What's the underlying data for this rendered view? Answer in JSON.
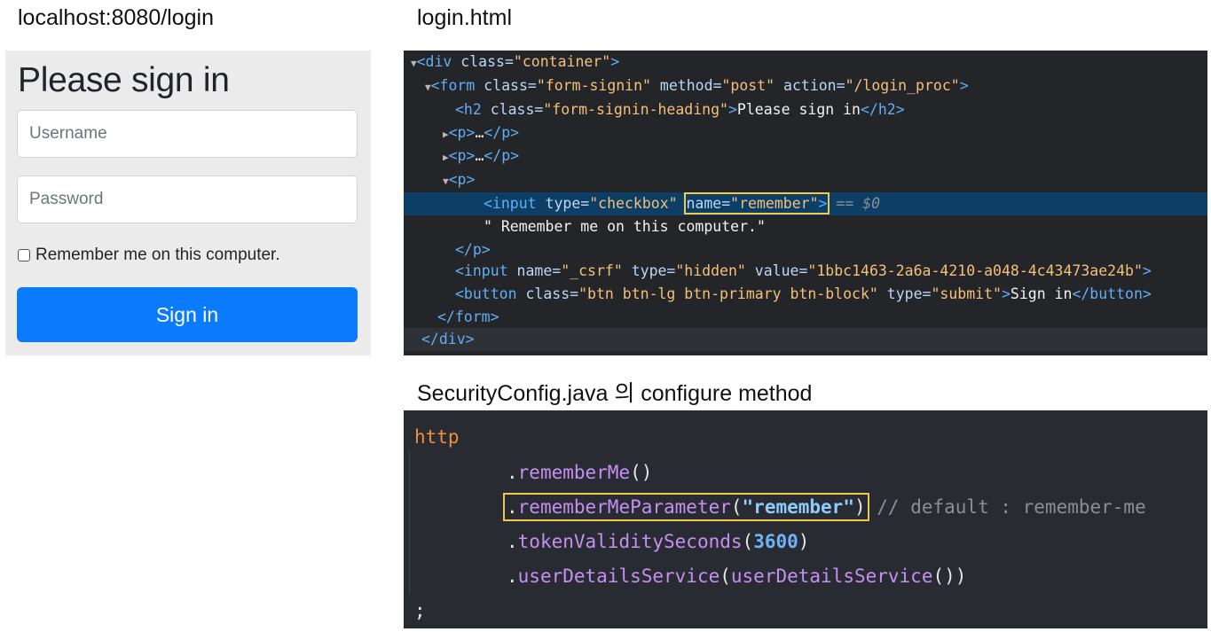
{
  "captions": {
    "login": "localhost:8080/login",
    "html": "login.html",
    "java": "SecurityConfig.java 의 configure method"
  },
  "login_form": {
    "title": "Please sign in",
    "username_placeholder": "Username",
    "password_placeholder": "Password",
    "remember_label": "Remember me on this computer.",
    "signin_label": "Sign in",
    "button_color": "#0b7bfe"
  },
  "devtools": {
    "l1_tag_open": "<div",
    "l1_attr": " class=",
    "l1_val": "\"container\"",
    "l1_close": ">",
    "l2_tag_open": "<form",
    "l2_attr1": " class=",
    "l2_val1": "\"form-signin\"",
    "l2_attr2": " method=",
    "l2_val2": "\"post\"",
    "l2_attr3": " action=",
    "l2_val3": "\"/login_proc\"",
    "l2_close": ">",
    "l3_tag_open": "<h2",
    "l3_attr": " class=",
    "l3_val": "\"form-signin-heading\"",
    "l3_gt": ">",
    "l3_text": "Please sign in",
    "l3_end": "</h2>",
    "l4_tag": "<p>",
    "l4_text": "…",
    "l4_end": "</p>",
    "l5_tag": "<p>",
    "l5_text": "…",
    "l5_end": "</p>",
    "l6_tag": "<p>",
    "l7_tag_open": "<input",
    "l7_attr1": " type=",
    "l7_val1": "\"checkbox\"",
    "l7_attr2": "name=",
    "l7_val2": "\"remember\"",
    "l7_close": ">",
    "l7_eq": " == ",
    "l7_dollar": "$0",
    "l8_text": "\" Remember me on this computer.\"",
    "l9_tag": "</p>",
    "l10_tag_open": "<input",
    "l10_attr1": " name=",
    "l10_val1": "\"_csrf\"",
    "l10_attr2": " type=",
    "l10_val2": "\"hidden\"",
    "l10_attr3": " value=",
    "l10_val3": "\"1bbc1463-2a6a-4210-a048-4c43473ae24b\"",
    "l10_close": ">",
    "l11_tag_open": "<button",
    "l11_attr1": " class=",
    "l11_val1": "\"btn btn-lg btn-primary btn-block\"",
    "l11_attr2": " type=",
    "l11_val2": "\"submit\"",
    "l11_gt": ">",
    "l11_text": "Sign in",
    "l11_end": "</button>",
    "l12_tag": "</form>",
    "l13_tag": "</div>"
  },
  "java": {
    "http": "http",
    "l2_method": "rememberMe",
    "l2_parens": "()",
    "l3_method": "rememberMeParameter",
    "l3_open": "(",
    "l3_string": "\"remember\"",
    "l3_close": ")",
    "l3_comment": "// default : remember-me",
    "l4_method": "tokenValiditySeconds",
    "l4_open": "(",
    "l4_number": "3600",
    "l4_close": ")",
    "l5_method": "userDetailsService",
    "l5_open": "(",
    "l5_inner": "userDetailsService",
    "l5_close": "())",
    "semicolon": ";",
    "dot": "."
  }
}
